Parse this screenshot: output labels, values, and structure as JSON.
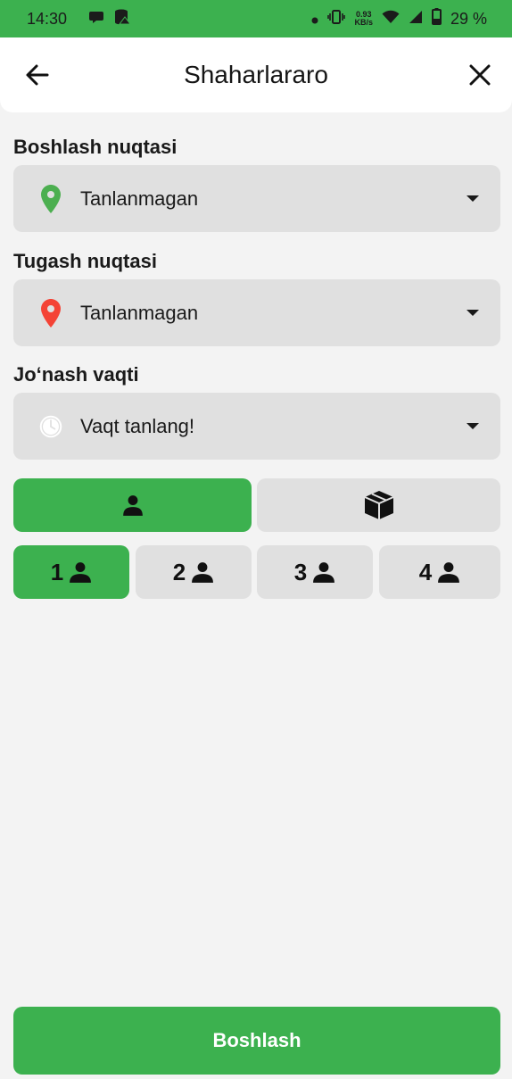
{
  "status_bar": {
    "time": "14:30",
    "net_speed_value": "0.93",
    "net_speed_unit": "KB/s",
    "battery": "29 %",
    "icons": [
      "chat-icon",
      "storage-alert-icon",
      "dot-icon",
      "vibrate-icon",
      "wifi-icon",
      "signal-icon",
      "battery-icon"
    ]
  },
  "header": {
    "title": "Shaharlararo",
    "back_icon": "arrow-left-icon",
    "close_icon": "close-icon"
  },
  "form": {
    "start_point": {
      "label": "Boshlash nuqtasi",
      "value": "Tanlanmagan",
      "icon": "location-pin-green-icon"
    },
    "end_point": {
      "label": "Tugash nuqtasi",
      "value": "Tanlanmagan",
      "icon": "location-pin-red-icon"
    },
    "departure_time": {
      "label": "Jo‘nash vaqti",
      "value": "Vaqt tanlang!",
      "icon": "clock-icon"
    }
  },
  "mode_tabs": [
    {
      "icon": "person-icon",
      "active": true
    },
    {
      "icon": "package-icon",
      "active": false
    }
  ],
  "passenger_counts": [
    {
      "num": "1",
      "active": true
    },
    {
      "num": "2",
      "active": false
    },
    {
      "num": "3",
      "active": false
    },
    {
      "num": "4",
      "active": false
    }
  ],
  "submit": {
    "label": "Boshlash"
  },
  "colors": {
    "accent": "#3cb14f",
    "field_bg": "#e0e0e0",
    "page_bg": "#f3f3f3",
    "pin_green": "#4caf50",
    "pin_red": "#f44336"
  }
}
